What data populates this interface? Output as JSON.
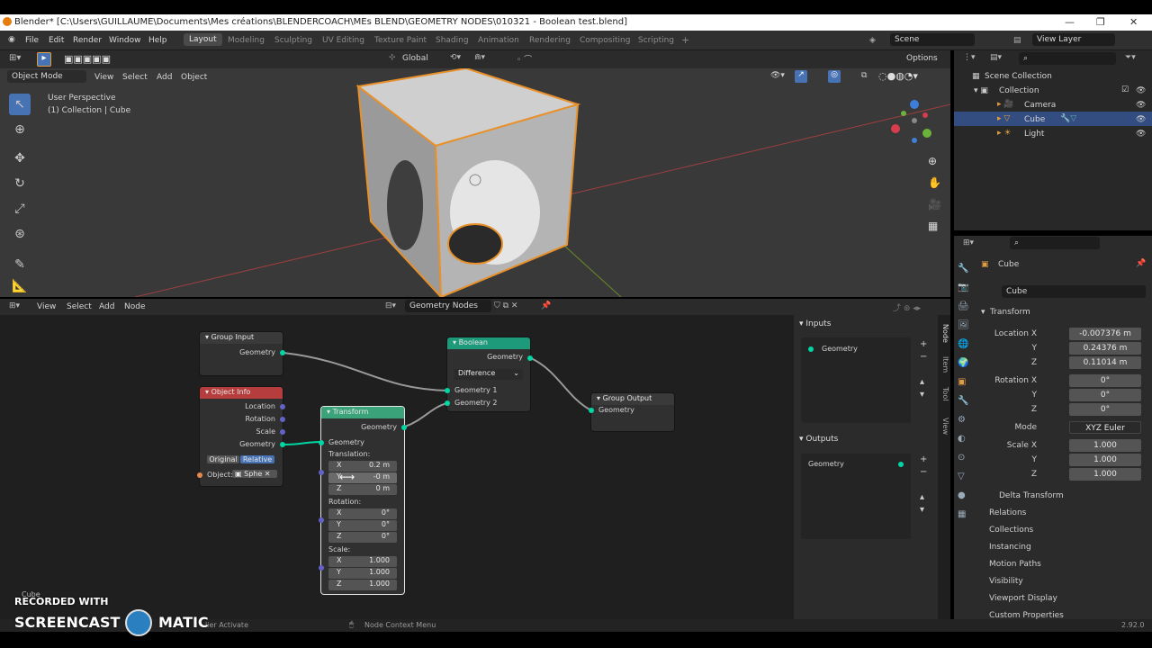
{
  "window": {
    "title": "Blender* [C:\\Users\\GUILLAUME\\Documents\\Mes créations\\BLENDERCOACH\\MEs BLEND\\GEOMETRY NODES\\010321 - Boolean test.blend]"
  },
  "menu": {
    "items": [
      "File",
      "Edit",
      "Render",
      "Window",
      "Help"
    ],
    "workspaces": [
      "Layout",
      "Modeling",
      "Sculpting",
      "UV Editing",
      "Texture Paint",
      "Shading",
      "Animation",
      "Rendering",
      "Compositing",
      "Scripting"
    ],
    "plus": "+",
    "scene": "Scene",
    "view_layer": "View Layer"
  },
  "viewport": {
    "mode": "Object Mode",
    "menus": [
      "View",
      "Select",
      "Add",
      "Object"
    ],
    "orientation": "Global",
    "options": "Options",
    "info_line1": "User Perspective",
    "info_line2": "(1) Collection | Cube"
  },
  "outliner": {
    "scene_collection": "Scene Collection",
    "collection": "Collection",
    "items": [
      "Camera",
      "Cube",
      "Light"
    ]
  },
  "properties": {
    "object_name": "Cube",
    "data_name": "Cube",
    "transform": "Transform",
    "location": {
      "label": "Location X",
      "x": "-0.007376 m",
      "y": "0.24376 m",
      "z": "0.11014 m"
    },
    "rotation": {
      "label": "Rotation X",
      "x": "0°",
      "y": "0°",
      "z": "0°"
    },
    "mode_label": "Mode",
    "mode": "XYZ Euler",
    "scale": {
      "label": "Scale X",
      "x": "1.000",
      "y": "1.000",
      "z": "1.000"
    },
    "y_label": "Y",
    "z_label": "Z",
    "sections": [
      "Delta Transform",
      "Relations",
      "Collections",
      "Instancing",
      "Motion Paths",
      "Visibility",
      "Viewport Display",
      "Custom Properties"
    ]
  },
  "node_editor": {
    "menus": [
      "View",
      "Select",
      "Add",
      "Node"
    ],
    "tree_name": "Geometry Nodes",
    "inputs_title": "Inputs",
    "outputs_title": "Outputs",
    "input_item": "Geometry",
    "output_item": "Geometry",
    "tabs": [
      "Node",
      "Item",
      "Tool",
      "View"
    ]
  },
  "nodes": {
    "group_input": {
      "title": "Group Input",
      "out": "Geometry"
    },
    "object_info": {
      "title": "Object Info",
      "outs": [
        "Location",
        "Rotation",
        "Scale",
        "Geometry"
      ],
      "opt_a": "Original",
      "opt_b": "Relative",
      "object_label": "Object:",
      "object_value": "Sphe"
    },
    "transform": {
      "title": "Transform",
      "out": "Geometry",
      "in": "Geometry",
      "translation": "Translation:",
      "tx": "0.2 m",
      "ty": "-0 m",
      "tz": "0 m",
      "rotation": "Rotation:",
      "rx": "0°",
      "ry": "0°",
      "rz": "0°",
      "scale": "Scale:",
      "sx": "1.000",
      "sy": "1.000",
      "sz": "1.000",
      "x": "X",
      "y": "Y",
      "z": "Z"
    },
    "boolean": {
      "title": "Boolean",
      "out": "Geometry",
      "op": "Difference",
      "in1": "Geometry 1",
      "in2": "Geometry 2"
    },
    "group_output": {
      "title": "Group Output",
      "in": "Geometry"
    }
  },
  "status": {
    "left": "Cube",
    "hint1": "lier Activate",
    "hint2": "Node Context Menu",
    "version": "2.92.0"
  },
  "watermark": {
    "line1": "RECORDED WITH",
    "line2a": "SCREENCAST",
    "line2b": "MATIC"
  }
}
